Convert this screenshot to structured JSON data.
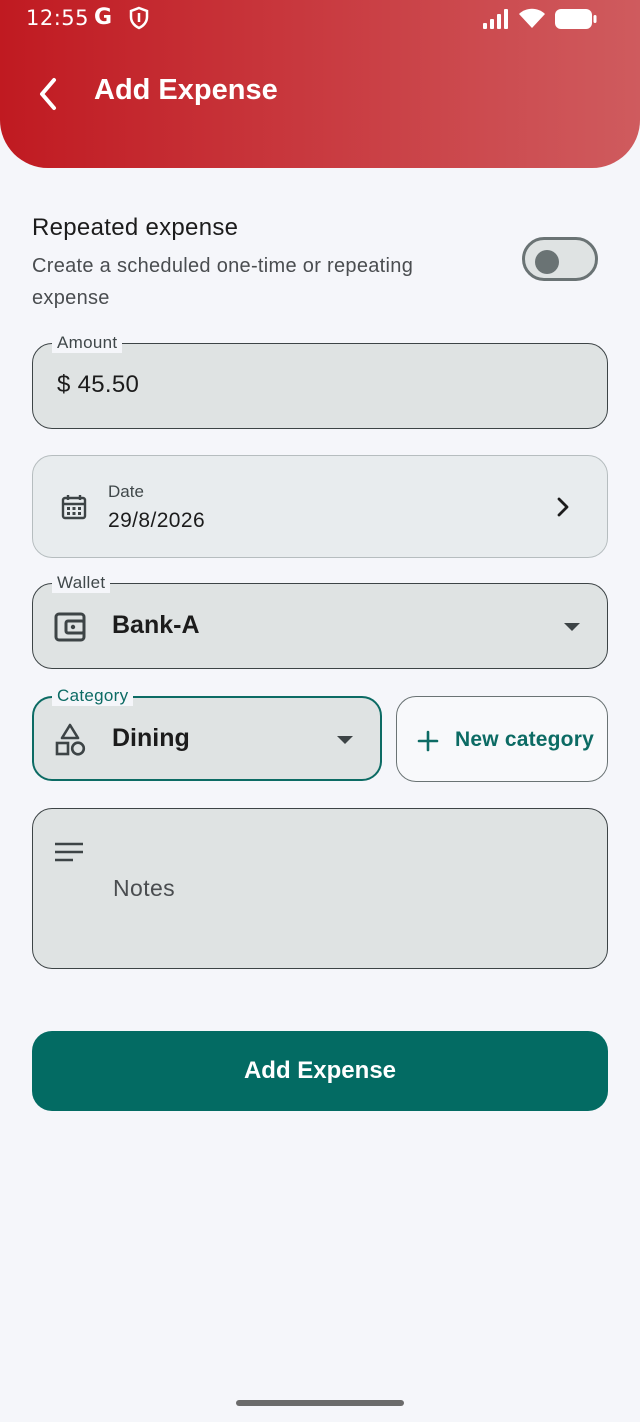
{
  "status_bar": {
    "time": "12:55",
    "g_label": "G",
    "icons": [
      "google-icon",
      "shield-icon",
      "signal-icon",
      "wifi-icon",
      "battery-icon"
    ]
  },
  "header": {
    "title": "Add Expense",
    "back_icon": "arrow-back-icon"
  },
  "repeated": {
    "title": "Repeated expense",
    "subtitle": "Create a scheduled one-time or repeating expense",
    "enabled": false
  },
  "amount": {
    "label": "Amount",
    "value": "$ 45.50"
  },
  "date": {
    "label": "Date",
    "value": "29/8/2026",
    "icon": "calendar-icon"
  },
  "wallet": {
    "label": "Wallet",
    "value": "Bank-A",
    "icon": "wallet-icon"
  },
  "category": {
    "label": "Category",
    "value": "Dining",
    "icon": "category-shapes-icon",
    "new_button_label": "New category"
  },
  "notes": {
    "placeholder": "Notes",
    "icon": "notes-lines-icon"
  },
  "submit": {
    "label": "Add Expense"
  },
  "colors": {
    "header_start": "#c01a21",
    "header_end": "#cf5b5e",
    "accent_teal": "#036b63",
    "field_bg": "#dfe3e3",
    "page_bg": "#f5f6fa"
  }
}
